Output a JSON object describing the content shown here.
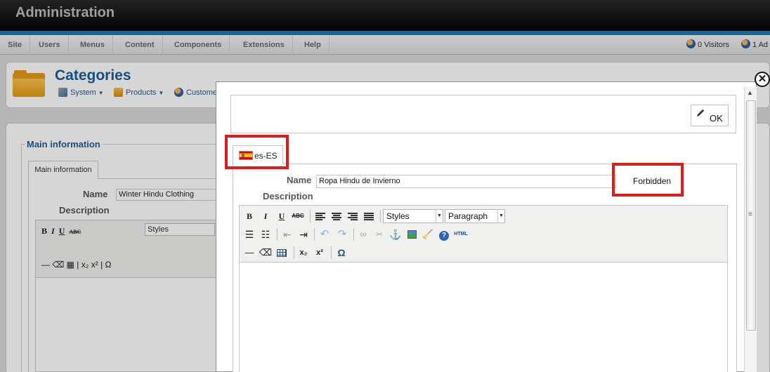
{
  "app": {
    "title": "Administration"
  },
  "menu": {
    "items": [
      "Site",
      "Users",
      "Menus",
      "Content",
      "Components",
      "Extensions",
      "Help"
    ],
    "visitors": "0 Visitors",
    "admins": "1 Ad"
  },
  "page": {
    "title": "Categories",
    "subnav": [
      "System",
      "Products",
      "Custome"
    ]
  },
  "background_form": {
    "legend": "Main information",
    "tab": "Main information",
    "name_label": "Name",
    "name_value": "Winter Hindu Clothing",
    "description_label": "Description",
    "styles": "Styles"
  },
  "modal": {
    "ok_label": "OK",
    "language_tab": "es-ES",
    "name_label": "Name",
    "name_value": "Ropa Hindu de Invierno",
    "status_text": "Forbidden",
    "description_label": "Description",
    "editor": {
      "styles": "Styles",
      "format": "Paragraph",
      "html_label": "HTML",
      "bold": "B",
      "italic": "I",
      "underline": "U",
      "strike": "ABC",
      "omega": "Ω"
    }
  },
  "colors": {
    "highlight_box": "#e21a1a",
    "title_blue": "#1a5d99",
    "strip_blue": "#1c78b5"
  }
}
